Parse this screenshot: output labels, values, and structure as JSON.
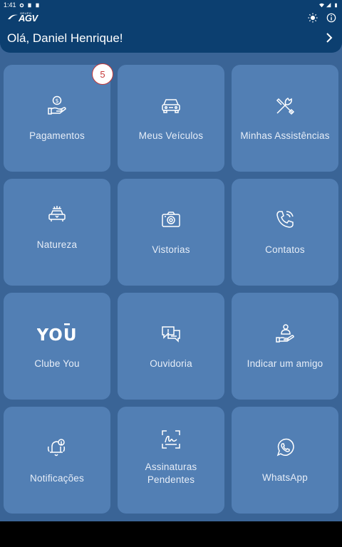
{
  "status_bar": {
    "time": "1:41"
  },
  "header": {
    "logo_small": "GRUPO",
    "logo_main": "AGV",
    "greeting": "Olá, Daniel Henrique!",
    "icons": [
      "brightness-icon",
      "info-icon"
    ]
  },
  "tiles": [
    {
      "label": "Pagamentos",
      "icon": "payment-hand-icon",
      "badge": "5"
    },
    {
      "label": "Meus Veículos",
      "icon": "car-icon"
    },
    {
      "label": "Minhas Assistências",
      "icon": "tools-icon"
    },
    {
      "label": "Natureza",
      "icon": "nature-car-icon"
    },
    {
      "label": "Vistorias",
      "icon": "camera-icon"
    },
    {
      "label": "Contatos",
      "icon": "phone-icon"
    },
    {
      "label": "Clube You",
      "icon": "you-logo"
    },
    {
      "label": "Ouvidoria",
      "icon": "chat-alert-icon"
    },
    {
      "label": "Indicar um amigo",
      "icon": "refer-friend-icon"
    },
    {
      "label": "Notificações",
      "icon": "bell-icon"
    },
    {
      "label": "Assinaturas\nPendentes",
      "icon": "signature-icon"
    },
    {
      "label": "WhatsApp",
      "icon": "whatsapp-icon"
    }
  ],
  "you_logo_text": "YOU",
  "colors": {
    "header": "#0c3f70",
    "background": "#3a6496",
    "tile": "#527fb4",
    "badge": "#c63a3a"
  }
}
